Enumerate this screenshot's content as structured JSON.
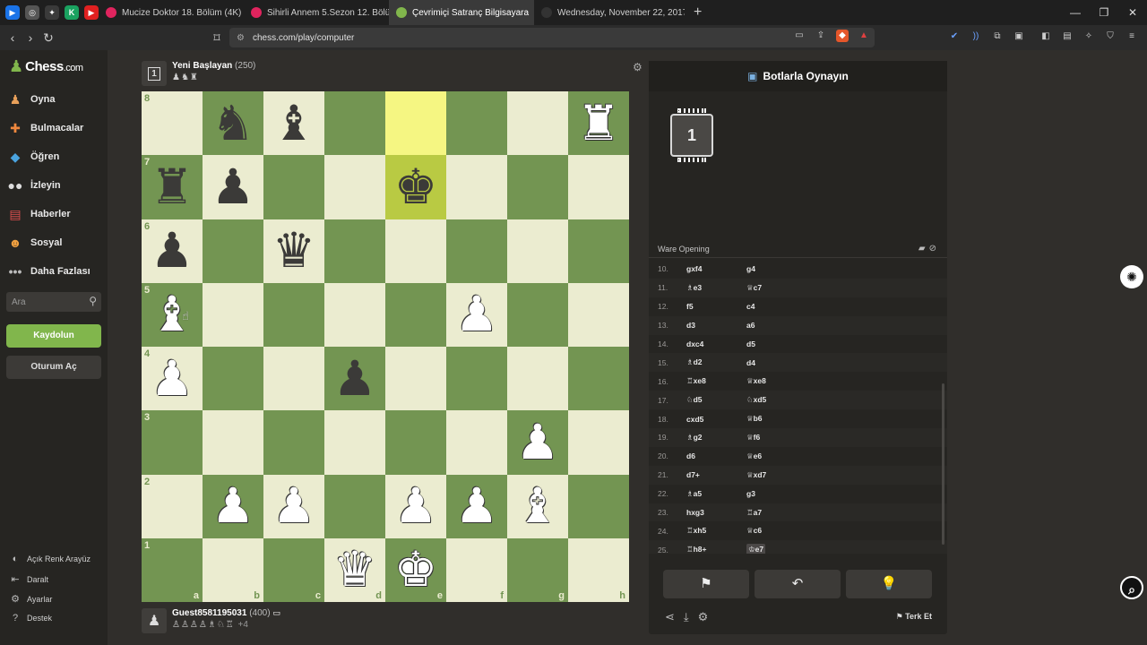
{
  "browser": {
    "tabs": [
      {
        "title": "Mucize Doktor 18. Bölüm (4K) - YouT",
        "color": "#e0245e"
      },
      {
        "title": "Sihirli Annem 5.Sezon 12. Bölüm - Yo",
        "color": "#e0245e"
      },
      {
        "title": "Çevrimiçi Satranç Bilgisayara",
        "color": "#81b64c"
      },
      {
        "title": "Wednesday, November 22, 2017 The",
        "color": "#333333"
      }
    ],
    "url": "chess.com/play/computer"
  },
  "sidebar": {
    "logo": "Chess",
    "logo_suffix": ".com",
    "nav": [
      {
        "label": "Oyna",
        "icon": "pawn-icon"
      },
      {
        "label": "Bulmacalar",
        "icon": "puzzle-icon"
      },
      {
        "label": "Öğren",
        "icon": "cap-icon"
      },
      {
        "label": "İzleyin",
        "icon": "binoculars-icon"
      },
      {
        "label": "Haberler",
        "icon": "news-icon"
      },
      {
        "label": "Sosyal",
        "icon": "people-icon"
      },
      {
        "label": "Daha Fazlası",
        "icon": "more-icon"
      }
    ],
    "search_placeholder": "Ara",
    "signup": "Kaydolun",
    "login": "Oturum Aç",
    "bottom": [
      {
        "label": "Açık Renk Arayüz"
      },
      {
        "label": "Daralt"
      },
      {
        "label": "Ayarlar"
      },
      {
        "label": "Destek"
      }
    ]
  },
  "top_player": {
    "name": "Yeni Başlayan",
    "rating": "(250)",
    "badge": "1",
    "captured": "♟♞♜"
  },
  "bottom_player": {
    "name": "Guest8581195031",
    "rating": "(400)",
    "captured": "♙♙♙♙♗♘♖",
    "plus": "+4"
  },
  "board": {
    "files": [
      "a",
      "b",
      "c",
      "d",
      "e",
      "f",
      "g",
      "h"
    ],
    "ranks": [
      "8",
      "7",
      "6",
      "5",
      "4",
      "3",
      "2",
      "1"
    ],
    "highlights": [
      "e8",
      "e7"
    ],
    "pieces": {
      "b8": "bN",
      "c8": "bB",
      "h8": "wR",
      "a7": "bR",
      "b7": "bP",
      "e7": "bK",
      "a6": "bP",
      "c6": "bQ",
      "a5": "wB",
      "f5": "wP",
      "a4": "wP",
      "d4": "bP",
      "g3": "wP",
      "b2": "wP",
      "c2": "wP",
      "e2": "wP",
      "f2": "wP",
      "g2": "wB",
      "d1": "wQ",
      "e1": "wK"
    }
  },
  "panel": {
    "title": "Botlarla Oynayın",
    "bot_level": "1",
    "opening": "Ware Opening",
    "moves": [
      {
        "n": "10.",
        "w": "gxf4",
        "b": "g4"
      },
      {
        "n": "11.",
        "w": "♗e3",
        "b": "♕c7"
      },
      {
        "n": "12.",
        "w": "f5",
        "b": "c4"
      },
      {
        "n": "13.",
        "w": "d3",
        "b": "a6"
      },
      {
        "n": "14.",
        "w": "dxc4",
        "b": "d5"
      },
      {
        "n": "15.",
        "w": "♗d2",
        "b": "d4"
      },
      {
        "n": "16.",
        "w": "♖xe8",
        "b": "♕xe8"
      },
      {
        "n": "17.",
        "w": "♘d5",
        "b": "♘xd5"
      },
      {
        "n": "18.",
        "w": "cxd5",
        "b": "♕b6"
      },
      {
        "n": "19.",
        "w": "♗g2",
        "b": "♕f6"
      },
      {
        "n": "20.",
        "w": "d6",
        "b": "♕e6"
      },
      {
        "n": "21.",
        "w": "d7+",
        "b": "♕xd7"
      },
      {
        "n": "22.",
        "w": "♗a5",
        "b": "g3"
      },
      {
        "n": "23.",
        "w": "hxg3",
        "b": "♖a7"
      },
      {
        "n": "24.",
        "w": "♖xh5",
        "b": "♕c6"
      },
      {
        "n": "25.",
        "w": "♖h8+",
        "b": "♔e7"
      }
    ],
    "resign": "Terk Et"
  }
}
